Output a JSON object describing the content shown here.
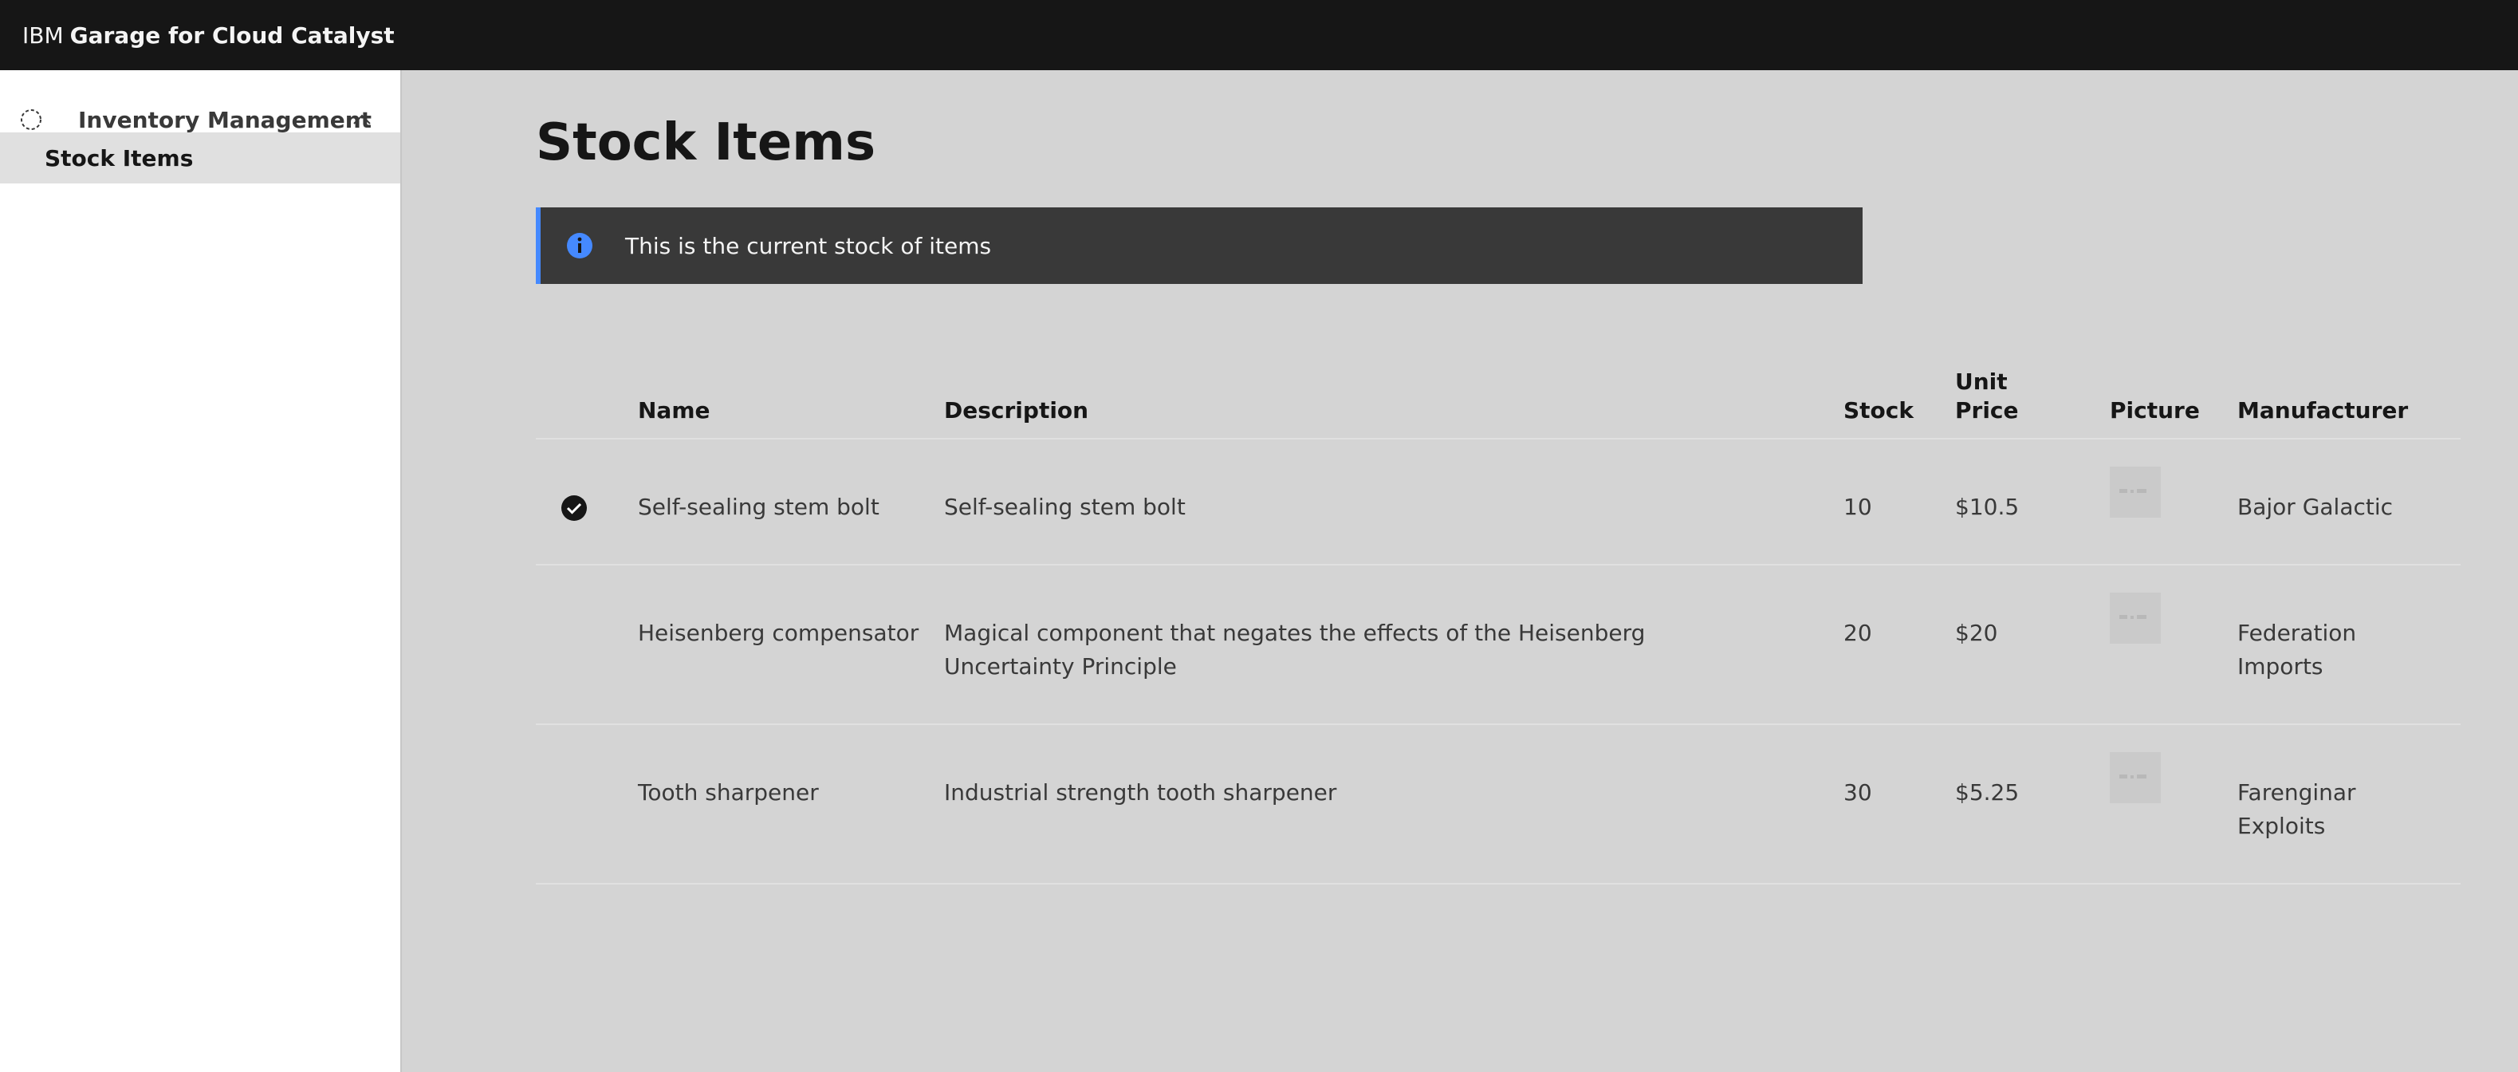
{
  "header": {
    "brand_prefix": "IBM",
    "brand_name": "Garage for Cloud Catalyst"
  },
  "sidebar": {
    "group_label": "Inventory Management",
    "items": [
      {
        "label": "Stock Items",
        "active": true
      }
    ]
  },
  "main": {
    "title": "Stock Items",
    "notification": "This is the current stock of items",
    "table": {
      "headers": {
        "name": "Name",
        "description": "Description",
        "stock": "Stock",
        "unit_price": "Unit Price",
        "picture": "Picture",
        "manufacturer": "Manufacturer"
      },
      "rows": [
        {
          "selected": true,
          "name": "Self-sealing stem bolt",
          "description": "Self-sealing stem bolt",
          "stock": "10",
          "unit_price": "$10.5",
          "manufacturer": "Bajor Galactic"
        },
        {
          "selected": false,
          "name": "Heisenberg compensator",
          "description": "Magical component that negates the effects of the Heisenberg Uncertainty Principle",
          "stock": "20",
          "unit_price": "$20",
          "manufacturer": "Federation Imports"
        },
        {
          "selected": false,
          "name": "Tooth sharpener",
          "description": "Industrial strength tooth sharpener",
          "stock": "30",
          "unit_price": "$5.25",
          "manufacturer": "Farenginar Exploits"
        }
      ]
    }
  },
  "colors": {
    "header_bg": "#161616",
    "accent_blue": "#4589ff",
    "notification_bg": "#393939",
    "content_bg": "#d4d4d4"
  }
}
